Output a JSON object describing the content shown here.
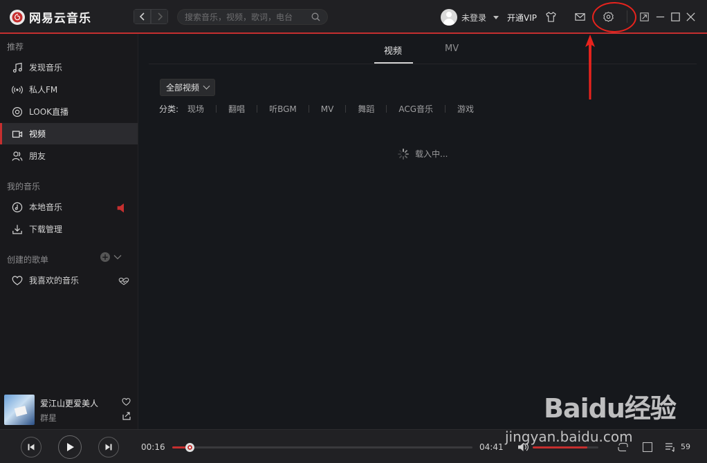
{
  "app": {
    "name": "网易云音乐",
    "accent": "#c62f2f"
  },
  "search": {
    "placeholder": "搜索音乐，视频，歌词，电台"
  },
  "user": {
    "name": "未登录",
    "vip_label": "开通VIP"
  },
  "titlebar_icons": [
    "shirt-icon",
    "mail-icon",
    "settings-icon",
    "mini-mode-icon",
    "minimize-icon",
    "maximize-icon",
    "close-icon"
  ],
  "sidebar": {
    "recommend_header": "推荐",
    "recommend_items": [
      {
        "label": "发现音乐",
        "icon": "music-note-icon"
      },
      {
        "label": "私人FM",
        "icon": "radio-icon"
      },
      {
        "label": "LOOK直播",
        "icon": "live-icon"
      },
      {
        "label": "视频",
        "icon": "video-icon",
        "active": true
      },
      {
        "label": "朋友",
        "icon": "friends-icon"
      }
    ],
    "my_music_header": "我的音乐",
    "my_music_items": [
      {
        "label": "本地音乐",
        "icon": "local-music-icon"
      },
      {
        "label": "下载管理",
        "icon": "download-icon"
      }
    ],
    "playlists_header": "创建的歌单",
    "playlist_items": [
      {
        "label": "我喜欢的音乐",
        "icon": "heart-icon"
      }
    ]
  },
  "now_playing": {
    "title": "爱江山更爱美人",
    "artist": "群星"
  },
  "main": {
    "tabs": [
      {
        "label": "视频",
        "active": true
      },
      {
        "label": "MV",
        "active": false
      }
    ],
    "filter_label": "全部视频",
    "category_label": "分类:",
    "categories": [
      "现场",
      "翻唱",
      "听BGM",
      "MV",
      "舞蹈",
      "ACG音乐",
      "游戏"
    ],
    "loading_text": "载入中..."
  },
  "player": {
    "current_time": "00:16",
    "total_time": "04:41",
    "progress_fraction": 0.057,
    "volume_fraction": 0.83,
    "playlist_count": "59"
  },
  "watermark": {
    "logo": "Baidu经验",
    "url": "jingyan.baidu.com"
  }
}
